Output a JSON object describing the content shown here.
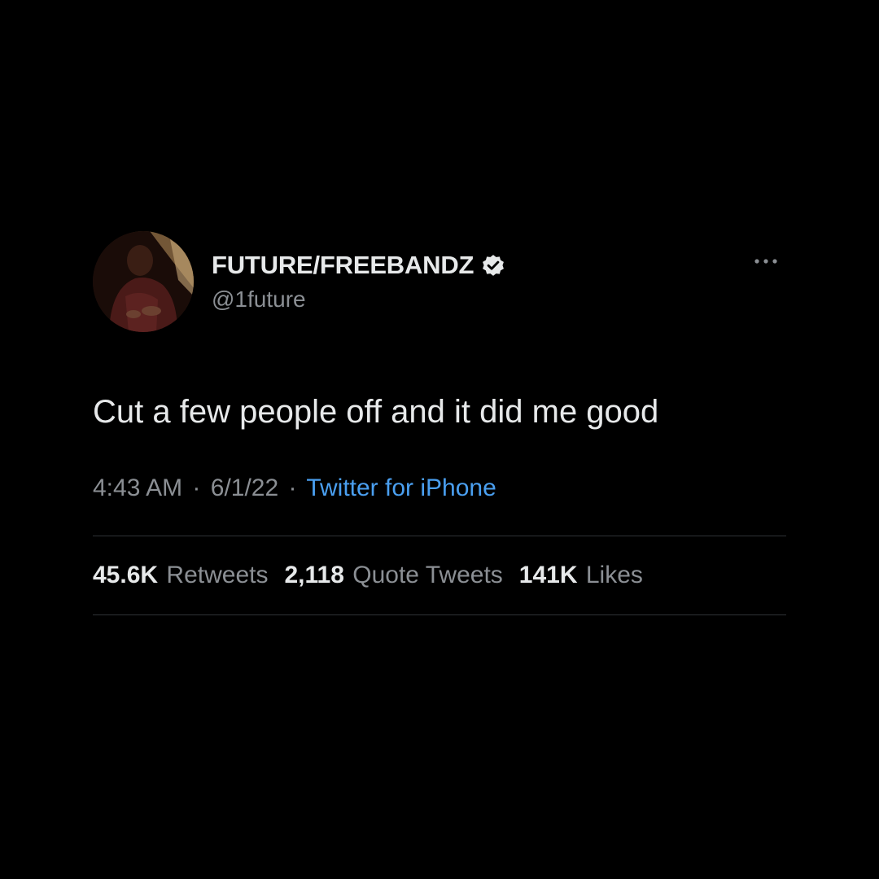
{
  "tweet": {
    "display_name": "FUTURE/FREEBANDZ",
    "handle": "@1future",
    "text": "Cut a few people off and it did me good",
    "time": "4:43 AM",
    "separator": "·",
    "date": "6/1/22",
    "source": "Twitter for iPhone",
    "verified": true
  },
  "stats": [
    {
      "count": "45.6K",
      "label": "Retweets"
    },
    {
      "count": "2,118",
      "label": "Quote Tweets"
    },
    {
      "count": "141K",
      "label": "Likes"
    }
  ],
  "colors": {
    "background": "#000000",
    "text": "#e7e9ea",
    "secondary": "#8b8f94",
    "link": "#4a9ff0",
    "divider": "#2f3336"
  },
  "icons": {
    "verified": "verified-badge-icon",
    "more": "more-options-icon"
  }
}
